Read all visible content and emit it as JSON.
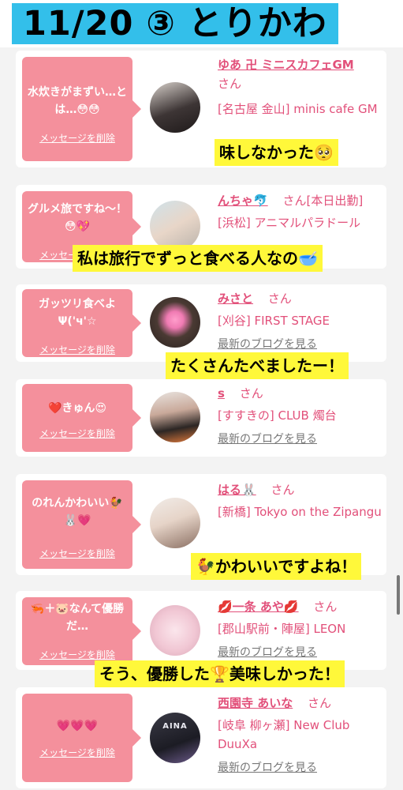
{
  "header": {
    "title": "11/20 ③ とりかわ"
  },
  "delete_label": "メッセージを削除",
  "blog_label": "最新のブログを見る",
  "honorific": "さん",
  "cards": [
    {
      "message": "水炊きがまずい…とは…😳😳",
      "name": "ゆあ 卍 ミニスカフェGM",
      "shop": "[名古屋 金山] minis cafe GM",
      "caption": "味しなかった🥺"
    },
    {
      "message": "グルメ旅ですね〜！😳💖",
      "name": "んちゃ🐬",
      "shop": "[浜松] アニマルパラドール",
      "status": "[本日出勤]",
      "caption": "私は旅行でずっと食べる人なの🥣"
    },
    {
      "message": "ガッツリ食べよΨ('ч'☆",
      "name": "みさと",
      "shop": "[刈谷] FIRST STAGE",
      "caption": "たくさんたべましたー！"
    },
    {
      "message": "❤️きゅん😍",
      "name": "s",
      "shop": "[すすきの] CLUB 燭台"
    },
    {
      "message": "のれんかわいい🐓🐰💗",
      "name": "はる🐰",
      "shop": "[新橋] Tokyo on the Zipangu",
      "caption": "🐓かわいいですよね！"
    },
    {
      "message": "🦐＋🐷なんて優勝だ…",
      "name": "💋一条 あや💋",
      "shop": "[郡山駅前・陣屋] LEON",
      "caption": "そう、優勝した🏆美味しかった！"
    },
    {
      "message": "💗💗💗",
      "name": "西園寺 あいな",
      "shop": "[岐阜 柳ヶ瀬] New Club DuuXa",
      "avatar_text": "AINA"
    }
  ],
  "colors": {
    "accent": "#e2507a",
    "bubble": "#f4909c",
    "header_bg": "#33bfea",
    "caption_bg": "#fff83a"
  }
}
